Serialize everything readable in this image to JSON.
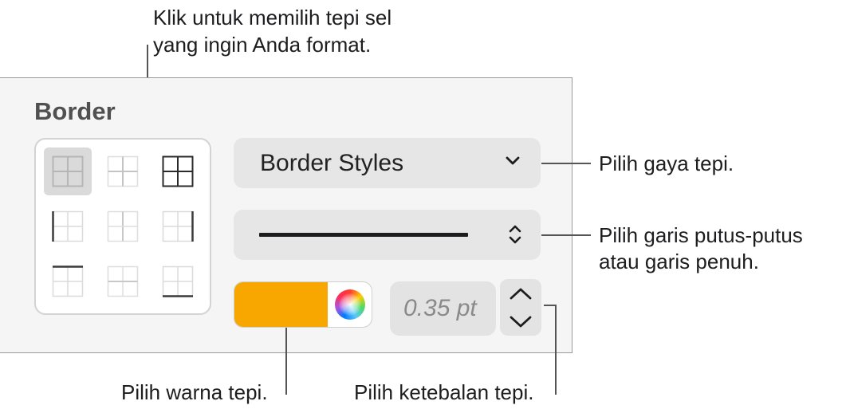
{
  "panel": {
    "title": "Border",
    "border_grid": {
      "cells": [
        {
          "name": "all-borders",
          "selected": true
        },
        {
          "name": "inner-borders",
          "selected": false
        },
        {
          "name": "outer-borders",
          "selected": false
        },
        {
          "name": "left-border",
          "selected": false
        },
        {
          "name": "inner-vertical-border",
          "selected": false
        },
        {
          "name": "right-border",
          "selected": false
        },
        {
          "name": "top-border",
          "selected": false
        },
        {
          "name": "inner-horizontal-border",
          "selected": false
        },
        {
          "name": "bottom-border",
          "selected": false
        }
      ]
    },
    "border_styles_label": "Border Styles",
    "line_style": "solid",
    "color_hex": "#f8a700",
    "width_value": "0.35 pt"
  },
  "callouts": {
    "grid_line1": "Klik untuk memilih tepi sel",
    "grid_line2": "yang ingin Anda format.",
    "style": "Pilih gaya tepi.",
    "line_line1": "Pilih garis putus-putus",
    "line_line2": "atau garis penuh.",
    "color": "Pilih warna tepi.",
    "thickness": "Pilih ketebalan tepi."
  },
  "icons": {
    "dropdown": "chevron-down-icon",
    "line_popup": "chevron-up-down-icon",
    "stepper_up": "chevron-up-icon",
    "stepper_down": "chevron-down-icon",
    "color_picker": "color-wheel-icon"
  }
}
